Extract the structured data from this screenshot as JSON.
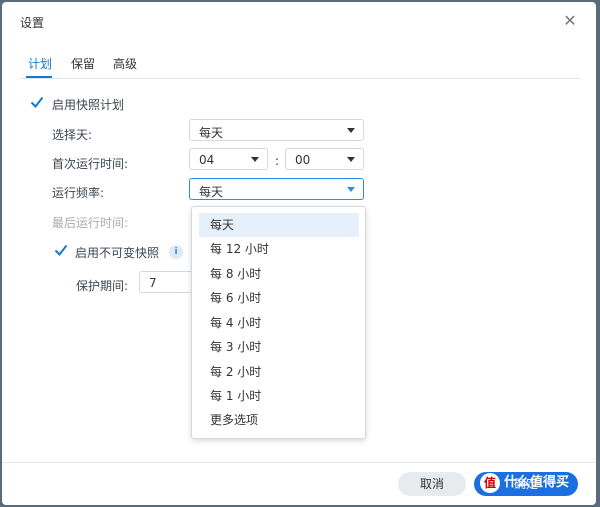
{
  "dialog": {
    "title": "设置",
    "close_icon": "close-icon"
  },
  "tabs": [
    {
      "label": "计划",
      "active": true
    },
    {
      "label": "保留",
      "active": false
    },
    {
      "label": "高级",
      "active": false
    }
  ],
  "form": {
    "enable_snapshot_schedule": {
      "label": "启用快照计划",
      "checked": true
    },
    "select_day": {
      "label": "选择天:",
      "value": "每天"
    },
    "first_run_time": {
      "label": "首次运行时间:",
      "hour": "04",
      "separator": ":",
      "minute": "00"
    },
    "run_frequency": {
      "label": "运行频率:",
      "value": "每天"
    },
    "last_run_time": {
      "label": "最后运行时间:"
    },
    "enable_immutable": {
      "label": "启用不可变快照",
      "checked": true,
      "info_icon": "i"
    },
    "protection_period": {
      "label": "保护期间:",
      "value": "7"
    }
  },
  "frequency_options": [
    {
      "label": "每天",
      "selected": true
    },
    {
      "label": "每 12 小时",
      "selected": false
    },
    {
      "label": "每 8 小时",
      "selected": false
    },
    {
      "label": "每 6 小时",
      "selected": false
    },
    {
      "label": "每 4 小时",
      "selected": false
    },
    {
      "label": "每 3 小时",
      "selected": false
    },
    {
      "label": "每 2 小时",
      "selected": false
    },
    {
      "label": "每 1 小时",
      "selected": false
    },
    {
      "label": "更多选项",
      "selected": false
    }
  ],
  "footer": {
    "cancel_label": "取消",
    "ok_label": "确定"
  },
  "watermark": {
    "logo": "值",
    "text": "什么值得买"
  },
  "colors": {
    "accent": "#0f7bd8",
    "primary_button": "#1b6fe0",
    "selected_option_bg": "#e6f0fb"
  }
}
